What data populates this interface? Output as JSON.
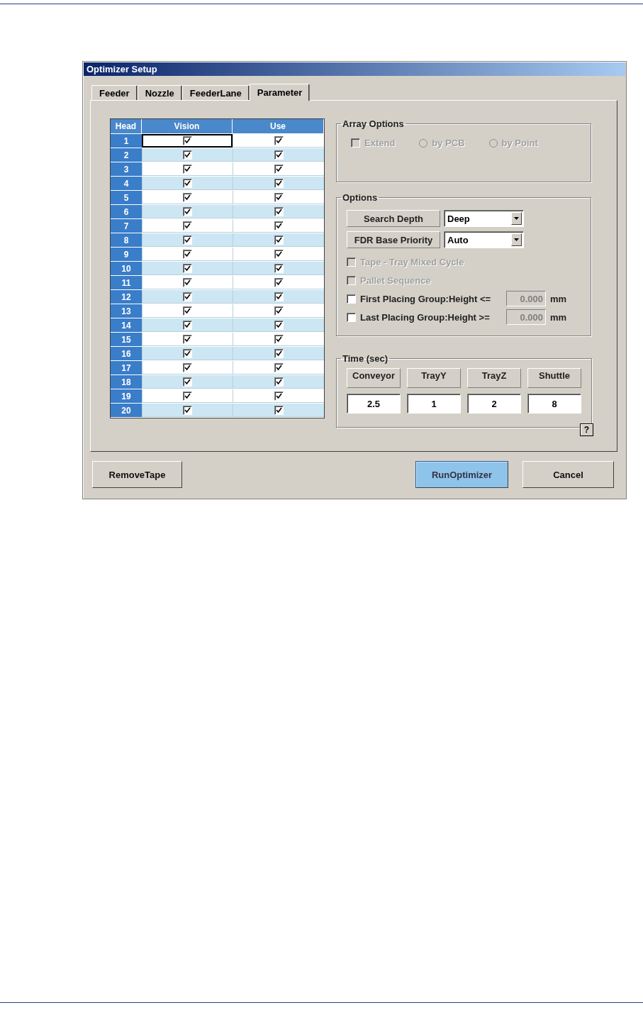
{
  "window": {
    "title": "Optimizer Setup"
  },
  "tabs": [
    {
      "label": "Feeder",
      "selected": false
    },
    {
      "label": "Nozzle",
      "selected": false
    },
    {
      "label": "FeederLane",
      "selected": false
    },
    {
      "label": "Parameter",
      "selected": true
    }
  ],
  "head_table": {
    "columns": [
      "Head",
      "Vision",
      "Use"
    ],
    "rows": [
      {
        "head": "1",
        "vision": true,
        "use": true,
        "focused": true
      },
      {
        "head": "2",
        "vision": true,
        "use": true,
        "focused": false
      },
      {
        "head": "3",
        "vision": true,
        "use": true,
        "focused": false
      },
      {
        "head": "4",
        "vision": true,
        "use": true,
        "focused": false
      },
      {
        "head": "5",
        "vision": true,
        "use": true,
        "focused": false
      },
      {
        "head": "6",
        "vision": true,
        "use": true,
        "focused": false
      },
      {
        "head": "7",
        "vision": true,
        "use": true,
        "focused": false
      },
      {
        "head": "8",
        "vision": true,
        "use": true,
        "focused": false
      },
      {
        "head": "9",
        "vision": true,
        "use": true,
        "focused": false
      },
      {
        "head": "10",
        "vision": true,
        "use": true,
        "focused": false
      },
      {
        "head": "11",
        "vision": true,
        "use": true,
        "focused": false
      },
      {
        "head": "12",
        "vision": true,
        "use": true,
        "focused": false
      },
      {
        "head": "13",
        "vision": true,
        "use": true,
        "focused": false
      },
      {
        "head": "14",
        "vision": true,
        "use": true,
        "focused": false
      },
      {
        "head": "15",
        "vision": true,
        "use": true,
        "focused": false
      },
      {
        "head": "16",
        "vision": true,
        "use": true,
        "focused": false
      },
      {
        "head": "17",
        "vision": true,
        "use": true,
        "focused": false
      },
      {
        "head": "18",
        "vision": true,
        "use": true,
        "focused": false
      },
      {
        "head": "19",
        "vision": true,
        "use": true,
        "focused": false
      },
      {
        "head": "20",
        "vision": true,
        "use": true,
        "focused": false
      }
    ]
  },
  "array_options": {
    "title": "Array Options",
    "items": [
      {
        "kind": "checkbox",
        "label": "Extend",
        "checked": false,
        "disabled": true
      },
      {
        "kind": "radio",
        "label": "by PCB",
        "selected": false,
        "disabled": true
      },
      {
        "kind": "radio",
        "label": "by Point",
        "selected": false,
        "disabled": true
      }
    ]
  },
  "options": {
    "title": "Options",
    "selects": [
      {
        "label": "Search Depth",
        "value": "Deep"
      },
      {
        "label": "FDR Base Priority",
        "value": "Auto"
      }
    ],
    "checks": [
      {
        "label": "Tape - Tray Mixed Cycle",
        "checked": false,
        "disabled": true
      },
      {
        "label": "Pallet Sequence",
        "checked": false,
        "disabled": true
      },
      {
        "label": "First Placing Group:Height <=",
        "checked": false,
        "disabled": false,
        "value": "0.000",
        "field_disabled": true,
        "unit": "mm"
      },
      {
        "label": "Last Placing Group:Height >=",
        "checked": false,
        "disabled": false,
        "value": "0.000",
        "field_disabled": true,
        "unit": "mm"
      }
    ]
  },
  "time": {
    "title": "Time (sec)",
    "fields": [
      {
        "label": "Conveyor",
        "value": "2.5"
      },
      {
        "label": "TrayY",
        "value": "1"
      },
      {
        "label": "TrayZ",
        "value": "2"
      },
      {
        "label": "Shuttle",
        "value": "8"
      }
    ]
  },
  "help_button": "?",
  "buttons": [
    {
      "label": "RemoveTape",
      "default": false
    },
    {
      "label": "RunOptimizer",
      "default": true
    },
    {
      "label": "Cancel",
      "default": false
    }
  ]
}
